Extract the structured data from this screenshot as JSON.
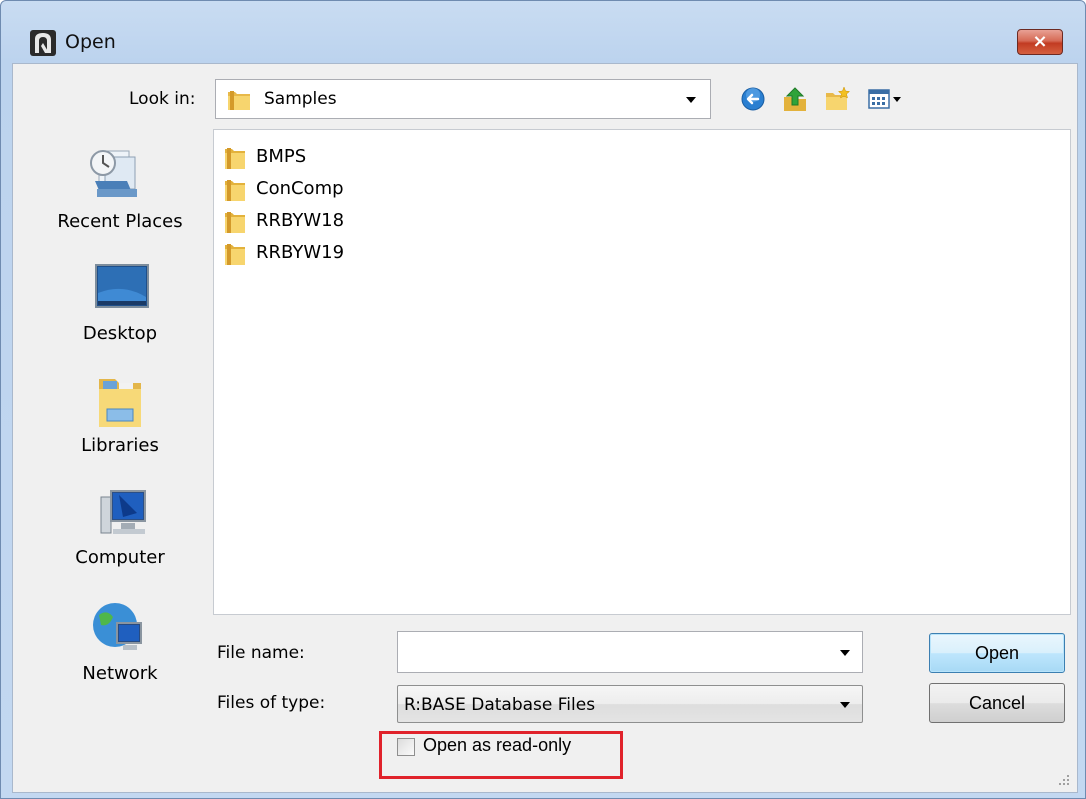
{
  "window": {
    "title": "Open",
    "close_symbol": "×",
    "app_icon": "rbase-app-icon"
  },
  "lookin": {
    "label": "Look in:",
    "value": "Samples",
    "folder_icon": "folder-icon"
  },
  "toolbar": {
    "back_icon": "back-arrow-icon",
    "up_icon": "up-one-level-icon",
    "new_folder_icon": "new-folder-icon",
    "views_icon": "view-menu-icon"
  },
  "places": [
    {
      "label": "Recent Places",
      "icon": "recent-places-icon"
    },
    {
      "label": "Desktop",
      "icon": "desktop-icon"
    },
    {
      "label": "Libraries",
      "icon": "libraries-icon"
    },
    {
      "label": "Computer",
      "icon": "computer-icon"
    },
    {
      "label": "Network",
      "icon": "network-icon"
    }
  ],
  "files": [
    {
      "name": "BMPS"
    },
    {
      "name": "ConComp"
    },
    {
      "name": "RRBYW18"
    },
    {
      "name": "RRBYW19"
    }
  ],
  "form": {
    "filename_label": "File name:",
    "filename_value": "",
    "filetype_label": "Files of type:",
    "filetype_value": "R:BASE Database Files",
    "readonly_label": "Open as read-only",
    "readonly_checked": false
  },
  "buttons": {
    "open": "Open",
    "cancel": "Cancel"
  },
  "colors": {
    "highlight_border": "#e0222b",
    "close_button": "#c23b22"
  }
}
